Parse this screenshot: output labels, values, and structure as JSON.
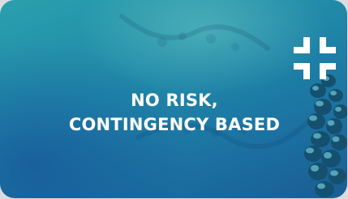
{
  "card": {
    "headline_line1": "NO RISK,",
    "headline_line2": "CONTINGENCY BASED",
    "logo_icon": "cross-brand-logo",
    "background": "dna-helix-photo",
    "colors": {
      "gradient_top": "#2aa0ad",
      "gradient_bottom": "#1a5c93",
      "text": "#ffffff"
    }
  }
}
